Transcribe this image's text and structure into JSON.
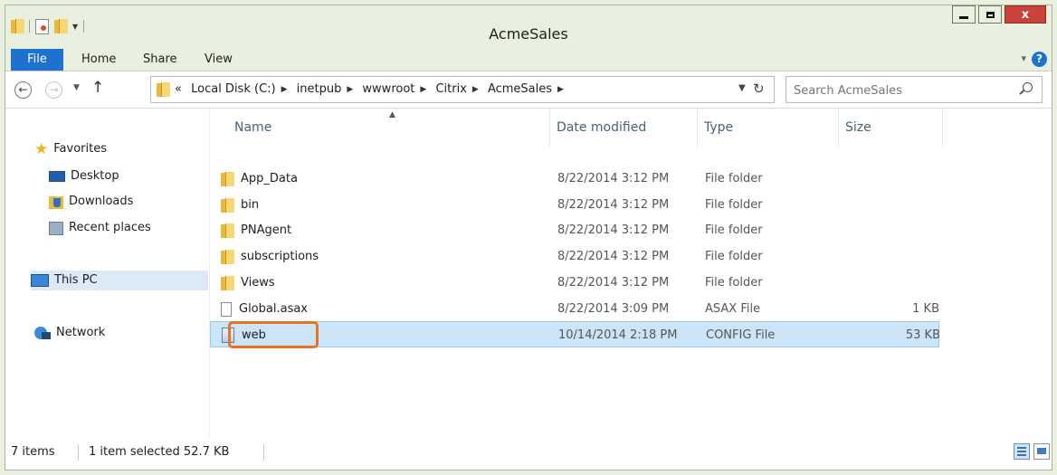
{
  "window": {
    "title": "AcmeSales",
    "close_glyph": "x"
  },
  "ribbon": {
    "tabs": [
      "File",
      "Home",
      "Share",
      "View"
    ],
    "help_glyph": "?"
  },
  "nav": {
    "back_glyph": "←",
    "forward_glyph": "→",
    "dropdown_glyph": "▼",
    "up_glyph": "↑",
    "path_prefix": "«",
    "path": [
      "Local Disk (C:)",
      "inetpub",
      "wwwroot",
      "Citrix",
      "AcmeSales"
    ],
    "refresh_glyph": "↻"
  },
  "search": {
    "placeholder": "Search AcmeSales"
  },
  "sidebar": {
    "favorites_label": "Favorites",
    "favorites": [
      "Desktop",
      "Downloads",
      "Recent places"
    ],
    "this_pc": "This PC",
    "network": "Network"
  },
  "columns": {
    "name": "Name",
    "date": "Date modified",
    "type": "Type",
    "size": "Size"
  },
  "files": [
    {
      "name": "App_Data",
      "date": "8/22/2014 3:12 PM",
      "type": "File folder",
      "size": "",
      "icon": "folder-icon"
    },
    {
      "name": "bin",
      "date": "8/22/2014 3:12 PM",
      "type": "File folder",
      "size": "",
      "icon": "folder-icon"
    },
    {
      "name": "PNAgent",
      "date": "8/22/2014 3:12 PM",
      "type": "File folder",
      "size": "",
      "icon": "folder-icon"
    },
    {
      "name": "subscriptions",
      "date": "8/22/2014 3:12 PM",
      "type": "File folder",
      "size": "",
      "icon": "folder-icon"
    },
    {
      "name": "Views",
      "date": "8/22/2014 3:12 PM",
      "type": "File folder",
      "size": "",
      "icon": "folder-icon"
    },
    {
      "name": "Global.asax",
      "date": "8/22/2014 3:09 PM",
      "type": "ASAX File",
      "size": "1 KB",
      "icon": "file-icon"
    },
    {
      "name": "web",
      "date": "10/14/2014 2:18 PM",
      "type": "CONFIG File",
      "size": "53 KB",
      "icon": "config-file-icon",
      "selected": true
    }
  ],
  "status": {
    "item_count": "7 items",
    "selection": "1 item selected  52.7 KB"
  },
  "colors": {
    "accent": "#1e72cf",
    "chrome": "#e9f0df",
    "highlight": "#e8721e",
    "selection": "#cce4f8"
  }
}
